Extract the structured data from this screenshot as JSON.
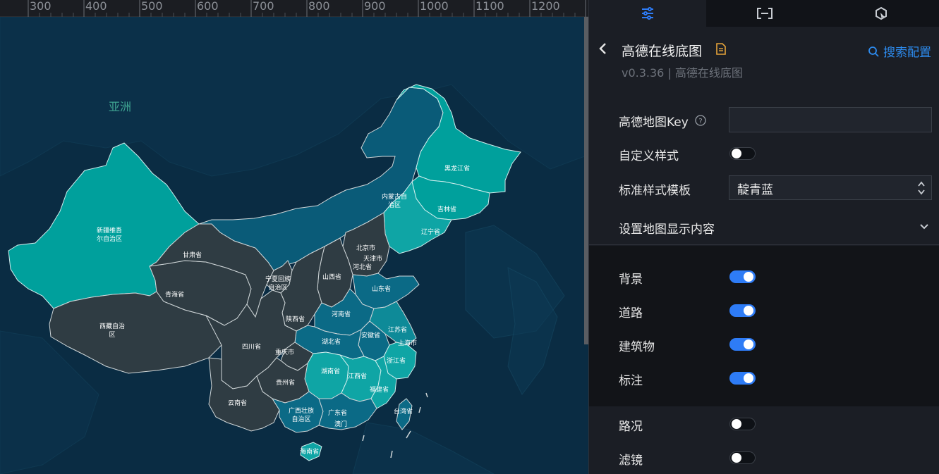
{
  "ruler": {
    "ticks": [
      "300",
      "400",
      "500",
      "600",
      "700",
      "800",
      "900",
      "1000",
      "1100",
      "1200"
    ]
  },
  "map": {
    "continent_label": "亚洲",
    "provinces": {
      "xinjiang": "新疆维吾\n尔自治区",
      "xizang": "西藏自治\n区",
      "qinghai": "青海省",
      "gansu": "甘肃省",
      "neimenggu": "内蒙古自\n治区",
      "heilongjiang": "黑龙江省",
      "jilin": "吉林省",
      "liaoning": "辽宁省",
      "beijing": "北京市",
      "tianjin": "天津市",
      "hebei": "河北省",
      "shanxi": "山西省",
      "ningxia": "宁夏回族\n自治区",
      "shaanxi": "陕西省",
      "shandong": "山东省",
      "henan": "河南省",
      "jiangsu": "江苏省",
      "anhui": "安徽省",
      "shanghai": "上海市",
      "hubei": "湖北省",
      "zhejiang": "浙江省",
      "sichuan": "四川省",
      "chongqing": "重庆市",
      "hunan": "湖南省",
      "jiangxi": "江西省",
      "fujian": "福建省",
      "guizhou": "贵州省",
      "yunnan": "云南省",
      "guangxi": "广西壮族\n自治区",
      "guangdong": "广东省",
      "macau": "澳门",
      "taiwan": "台湾省",
      "hainan": "海南省"
    }
  },
  "panel": {
    "tabs": [
      {
        "icon": "sliders-icon"
      },
      {
        "icon": "bracket-frame-icon"
      },
      {
        "icon": "interaction-icon"
      }
    ],
    "title": "高德在线底图",
    "version": "v0.3.36 | 高德在线底图",
    "search_label": "搜索配置",
    "fields": {
      "amap_key_label": "高德地图Key",
      "amap_key_value": "",
      "custom_style_label": "自定义样式",
      "template_label": "标准样式模板",
      "template_value": "靛青蓝",
      "display_section_label": "设置地图显示内容"
    },
    "display_items": [
      {
        "label": "背景",
        "on": true
      },
      {
        "label": "道路",
        "on": true
      },
      {
        "label": "建筑物",
        "on": true
      },
      {
        "label": "标注",
        "on": true
      }
    ],
    "extra_items": [
      {
        "label": "路况",
        "on": false
      },
      {
        "label": "滤镜",
        "on": false
      }
    ]
  },
  "colors": {
    "accent": "#2e7cf6",
    "link": "#2d8cf0",
    "map_bg": "#0a2c43",
    "province_dark": "#2f3d44",
    "province_teal": "#00a0a0"
  }
}
